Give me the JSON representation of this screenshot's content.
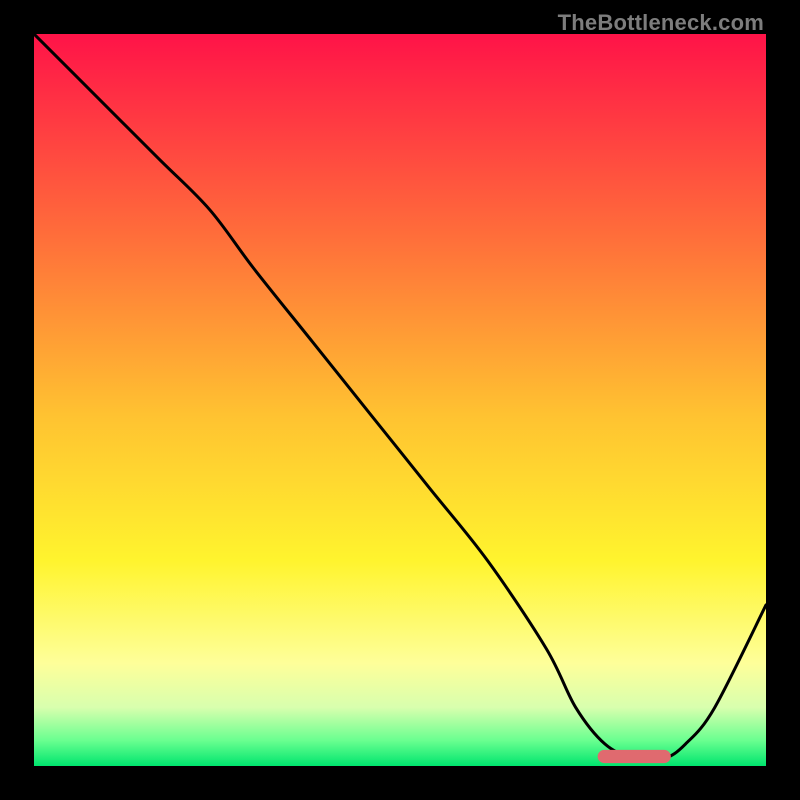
{
  "watermark": "TheBottleneck.com",
  "chart_data": {
    "type": "line",
    "title": "",
    "xlabel": "",
    "ylabel": "",
    "xlim": [
      0,
      100
    ],
    "ylim": [
      0,
      100
    ],
    "grid": false,
    "legend": false,
    "annotations": [],
    "background_gradient": {
      "top_to_bottom": [
        {
          "pos": 0.0,
          "color": "#ff1348"
        },
        {
          "pos": 0.28,
          "color": "#ff6f3a"
        },
        {
          "pos": 0.52,
          "color": "#ffc231"
        },
        {
          "pos": 0.72,
          "color": "#fff42e"
        },
        {
          "pos": 0.86,
          "color": "#feff9a"
        },
        {
          "pos": 0.92,
          "color": "#d8ffae"
        },
        {
          "pos": 0.965,
          "color": "#6aff90"
        },
        {
          "pos": 1.0,
          "color": "#00e56e"
        }
      ]
    },
    "series": [
      {
        "name": "bottleneck-curve",
        "color": "#000000",
        "x": [
          0,
          8,
          17,
          24,
          30,
          38,
          46,
          54,
          62,
          70,
          74,
          78,
          82,
          86,
          89,
          93,
          100
        ],
        "y": [
          100,
          92,
          83,
          76,
          68,
          58,
          48,
          38,
          28,
          16,
          8,
          3,
          1,
          1,
          3,
          8,
          22
        ]
      }
    ],
    "marker": {
      "name": "optimal-zone",
      "color": "#e06a6f",
      "x_start": 77,
      "x_end": 87,
      "y": 1.3,
      "thickness_pct": 1.8
    }
  }
}
